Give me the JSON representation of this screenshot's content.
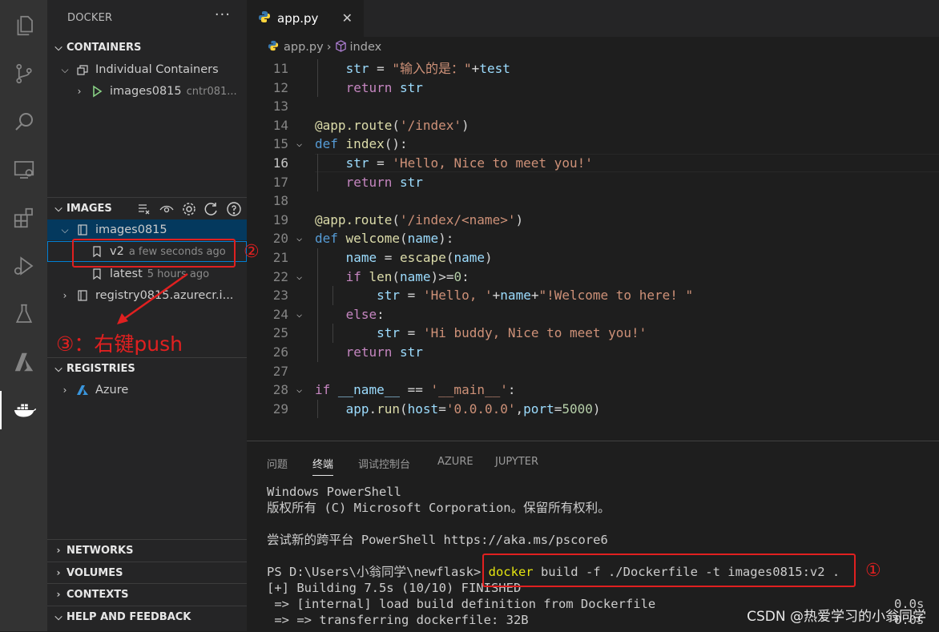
{
  "activity_bar": {
    "icons": [
      "explorer-icon",
      "source-control-icon",
      "search-icon",
      "remote-explorer-icon",
      "extensions-icon",
      "run-debug-icon",
      "testing-icon",
      "azure-icon",
      "docker-icon"
    ]
  },
  "sidebar": {
    "title": "DOCKER",
    "more": "···",
    "containers": {
      "header": "CONTAINERS",
      "group": "Individual Containers",
      "item_name": "images0815",
      "item_detail": "cntr081..."
    },
    "images": {
      "header": "IMAGES",
      "repo": "images0815",
      "tags": [
        {
          "name": "v2",
          "detail": "a few seconds ago"
        },
        {
          "name": "latest",
          "detail": "5 hours ago"
        }
      ],
      "registry": "registry0815.azurecr.i..."
    },
    "registries": {
      "header": "REGISTRIES",
      "item": "Azure"
    },
    "networks": "NETWORKS",
    "volumes": "VOLUMES",
    "contexts": "CONTEXTS",
    "help": "HELP AND FEEDBACK"
  },
  "editor": {
    "tab_label": "app.py",
    "breadcrumb_file": "app.py",
    "breadcrumb_symbol": "index",
    "lines": [
      {
        "n": "11",
        "text": "    str = \"输入的是：\"+test"
      },
      {
        "n": "12",
        "text": "    return str"
      },
      {
        "n": "13",
        "text": ""
      },
      {
        "n": "14",
        "text": "@app.route('/index')"
      },
      {
        "n": "15",
        "text": "def index():"
      },
      {
        "n": "16",
        "text": "    str = 'Hello, Nice to meet you!'"
      },
      {
        "n": "17",
        "text": "    return str"
      },
      {
        "n": "18",
        "text": ""
      },
      {
        "n": "19",
        "text": "@app.route('/index/<name>')"
      },
      {
        "n": "20",
        "text": "def welcome(name):"
      },
      {
        "n": "21",
        "text": "    name = escape(name)"
      },
      {
        "n": "22",
        "text": "    if len(name)>=0:"
      },
      {
        "n": "23",
        "text": "        str = 'Hello, '+name+\"!Welcome to here! \""
      },
      {
        "n": "24",
        "text": "    else:"
      },
      {
        "n": "25",
        "text": "        str = 'Hi buddy, Nice to meet you!'"
      },
      {
        "n": "26",
        "text": "    return str"
      },
      {
        "n": "27",
        "text": ""
      },
      {
        "n": "28",
        "text": "if __name__ == '__main__':"
      },
      {
        "n": "29",
        "text": "    app.run(host='0.0.0.0',port=5000)"
      }
    ]
  },
  "panel": {
    "tabs": [
      "问题",
      "终端",
      "调试控制台",
      "AZURE",
      "JUPYTER"
    ],
    "active_tab": "终端",
    "terminal": {
      "line1": "Windows PowerShell",
      "line2": "版权所有 (C) Microsoft Corporation。保留所有权利。",
      "line3": "尝试新的跨平台 PowerShell https://aka.ms/pscore6",
      "prompt": "PS D:\\Users\\小翁同学\\newflask> ",
      "cmd_docker": "docker",
      "cmd_rest": " build -f ./Dockerfile -t images0815:v2 .",
      "line5": "[+] Building 7.5s (10/10) FINISHED",
      "line6": " => [internal] load build definition from Dockerfile",
      "line6_time": "0.0s",
      "line7": " => => transferring dockerfile: 32B",
      "line7_time": "0.0s"
    }
  },
  "annotations": {
    "circle1": "①",
    "circle2": "②",
    "step3": "③：右键push"
  },
  "watermark": "CSDN @热爱学习的小翁同学",
  "colors": {
    "activity_bg": "#333333",
    "sidebar_bg": "#252526",
    "editor_bg": "#1e1e1e",
    "selection": "#04395e",
    "annotation_red": "#e02020",
    "terminal_yellow": "#e5e510",
    "terminal_blue": "#3b8eea"
  }
}
